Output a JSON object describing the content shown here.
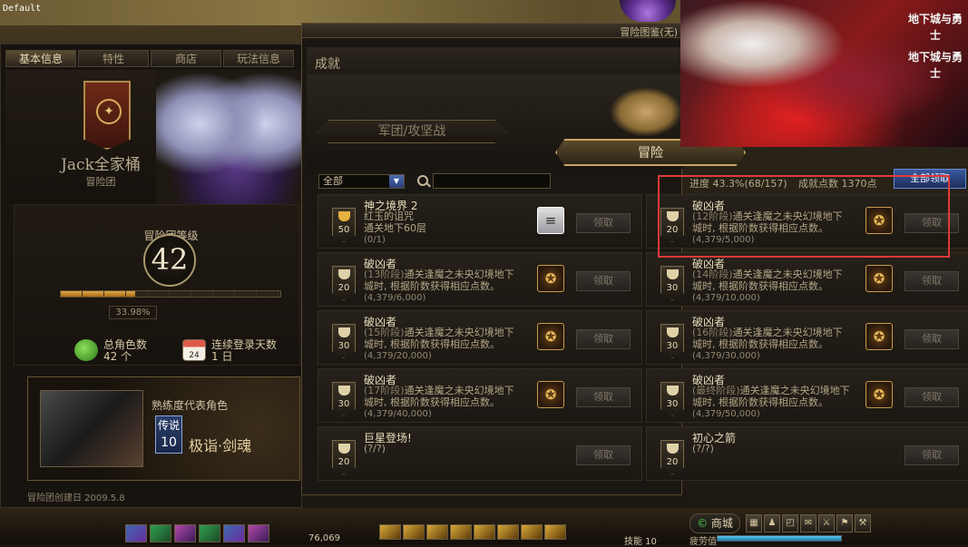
{
  "system": {
    "default_label": "Default"
  },
  "left_panel": {
    "tabs": [
      "基本信息",
      "特性",
      "商店",
      "玩法信息"
    ],
    "guild_name": "Jack全家桶",
    "guild_type": "冒险团",
    "level_label": "冒险团等级",
    "level": "42",
    "xp_percent_text": "33.98%",
    "xp_fraction": 0.3398,
    "total_chars_label": "总角色数",
    "total_chars_value": "42 个",
    "login_days_label": "连续登录天数",
    "login_days_value": "1 日",
    "calendar_day": "24",
    "rep_title": "熟练度代表角色",
    "rep_badge": "传说",
    "rep_level": "10",
    "rep_name": "极诣·剑魂",
    "founded": "冒险团创建日 2009.5.8"
  },
  "book": {
    "window_title": "冒险图鉴(无)",
    "section_title": "成就",
    "tab_war": "军团/攻坚战",
    "tab_adventure": "冒险",
    "filter_value": "全部",
    "search_placeholder": "",
    "progress_text": "进度  43.3%(68/157)",
    "points_text": "成就点数  1370点",
    "view_all_button": "全部领取"
  },
  "achievements": [
    {
      "name": "神之境界 2",
      "line1": "红玉的诅咒",
      "line2": "通关地下60层",
      "progress": "(0/1)",
      "points": "50",
      "reward": "scroll",
      "claim": "领取",
      "gold": true
    },
    {
      "name": "破凶者",
      "stage": "(12阶段)",
      "line1": "通关逢魔之未央幻境地下",
      "line2": "城时, 根据阶数获得相应点数。",
      "progress": "(4,379/5,000)",
      "points": "20",
      "reward": "emblem",
      "claim": "领取"
    },
    {
      "name": "破凶者",
      "stage": "(13阶段)",
      "line1": "通关逢魔之未央幻境地下",
      "line2": "城时, 根据阶数获得相应点数。",
      "progress": "(4,379/6,000)",
      "points": "20",
      "reward": "emblem",
      "claim": "领取"
    },
    {
      "name": "破凶者",
      "stage": "(14阶段)",
      "line1": "通关逢魔之未央幻境地下",
      "line2": "城时, 根据阶数获得相应点数。",
      "progress": "(4,379/10,000)",
      "points": "30",
      "reward": "emblem",
      "claim": "领取"
    },
    {
      "name": "破凶者",
      "stage": "(15阶段)",
      "line1": "通关逢魔之未央幻境地下",
      "line2": "城时, 根据阶数获得相应点数。",
      "progress": "(4,379/20,000)",
      "points": "30",
      "reward": "emblem",
      "claim": "领取"
    },
    {
      "name": "破凶者",
      "stage": "(16阶段)",
      "line1": "通关逢魔之未央幻境地下",
      "line2": "城时, 根据阶数获得相应点数。",
      "progress": "(4,379/30,000)",
      "points": "30",
      "reward": "emblem",
      "claim": "领取"
    },
    {
      "name": "破凶者",
      "stage": "(17阶段)",
      "line1": "通关逢魔之未央幻境地下",
      "line2": "城时, 根据阶数获得相应点数。",
      "progress": "(4,379/40,000)",
      "points": "30",
      "reward": "emblem",
      "claim": "领取"
    },
    {
      "name": "破凶者",
      "stage": "(最终阶段)",
      "line1": "通关逢魔之未央幻境地下",
      "line2": "城时, 根据阶数获得相应点数。",
      "progress": "(4,379/50,000)",
      "points": "30",
      "reward": "emblem",
      "claim": "领取"
    },
    {
      "name": "巨星登场!",
      "stage": "",
      "line1": "(?/?)",
      "line2": "",
      "progress": "",
      "points": "20",
      "reward": "none",
      "claim": "领取"
    },
    {
      "name": "初心之箭",
      "stage": "",
      "line1": "(?/?)",
      "line2": "",
      "progress": "",
      "points": "20",
      "reward": "none",
      "claim": "领取"
    }
  ],
  "ad": {
    "logo_line1": "地下城与勇士",
    "logo_line2": "地下城与勇士"
  },
  "hotbar": {
    "hp": "76,069",
    "skill_label": "技能  10",
    "shop": "商城",
    "fatigue_label": "疲劳值",
    "fatigue_fraction": 1.0,
    "menu_icons": [
      "grid-icon",
      "character-icon",
      "bag-icon",
      "mail-icon",
      "sword-icon",
      "guild-icon",
      "tools-icon"
    ]
  },
  "colors": {
    "highlight": "#e03a3a",
    "accent_gold": "#c7a463"
  }
}
